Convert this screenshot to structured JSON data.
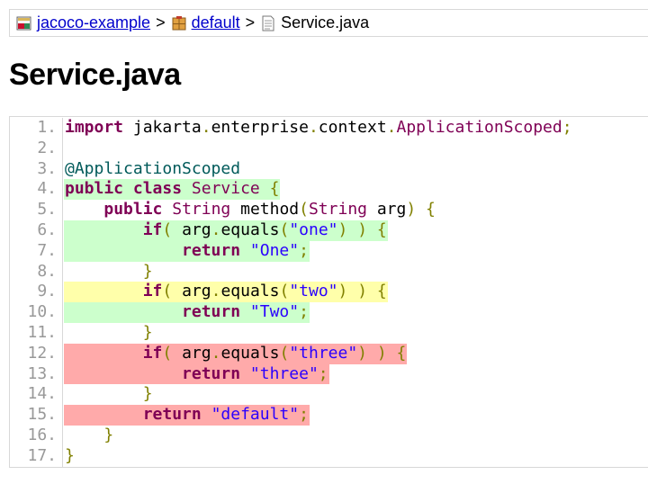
{
  "breadcrumb": {
    "project": "jacoco-example",
    "sep1": ">",
    "package": "default",
    "sep2": ">",
    "file": "Service.java",
    "project_icon": "project-icon",
    "package_icon": "package-icon",
    "file_icon": "java-file-icon"
  },
  "title": "Service.java",
  "colors": {
    "fully_covered": "#ccffcc",
    "partly_covered": "#ffffaa",
    "not_covered": "#ffaaaa",
    "keyword": "#7f0055",
    "string": "#2a00ff",
    "annotation": "#005a5a"
  },
  "lines": [
    {
      "num": "1.",
      "coverage": "none",
      "branch": "none",
      "segs": [
        [
          "kw",
          "import"
        ],
        [
          "",
          ""
        ],
        [
          "pl",
          " jakarta"
        ],
        [
          "pu",
          "."
        ],
        [
          "pl",
          "enterprise"
        ],
        [
          "pu",
          "."
        ],
        [
          "pl",
          "context"
        ],
        [
          "pu",
          "."
        ],
        [
          "ty",
          "ApplicationScoped"
        ],
        [
          "pu",
          ";"
        ]
      ]
    },
    {
      "num": "2.",
      "coverage": "none",
      "branch": "none",
      "segs": []
    },
    {
      "num": "3.",
      "coverage": "none",
      "branch": "none",
      "segs": [
        [
          "an",
          "@ApplicationScoped"
        ]
      ]
    },
    {
      "num": "4.",
      "coverage": "fc",
      "branch": "none",
      "segs": [
        [
          "kw",
          "public"
        ],
        [
          "pl",
          " "
        ],
        [
          "kw",
          "class"
        ],
        [
          "pl",
          " "
        ],
        [
          "ty",
          "Service"
        ],
        [
          "pl",
          " "
        ],
        [
          "pu",
          "{"
        ]
      ]
    },
    {
      "num": "5.",
      "coverage": "none",
      "branch": "none",
      "segs": [
        [
          "pl",
          "    "
        ],
        [
          "kw",
          "public"
        ],
        [
          "pl",
          " "
        ],
        [
          "ty",
          "String"
        ],
        [
          "pl",
          " method"
        ],
        [
          "pu",
          "("
        ],
        [
          "ty",
          "String"
        ],
        [
          "pl",
          " arg"
        ],
        [
          "pu",
          ")"
        ],
        [
          "pl",
          " "
        ],
        [
          "pu",
          "{"
        ]
      ]
    },
    {
      "num": "6.",
      "coverage": "fc",
      "branch": "green",
      "segs": [
        [
          "pl",
          "        "
        ],
        [
          "kw",
          "if"
        ],
        [
          "pu",
          "("
        ],
        [
          "pl",
          " arg"
        ],
        [
          "pu",
          "."
        ],
        [
          "pl",
          "equals"
        ],
        [
          "pu",
          "("
        ],
        [
          "st",
          "\"one\""
        ],
        [
          "pu",
          ")"
        ],
        [
          "pl",
          " "
        ],
        [
          "pu",
          ")"
        ],
        [
          "pl",
          " "
        ],
        [
          "pu",
          "{"
        ]
      ]
    },
    {
      "num": "7.",
      "coverage": "fc",
      "branch": "none",
      "segs": [
        [
          "pl",
          "            "
        ],
        [
          "kw",
          "return"
        ],
        [
          "pl",
          " "
        ],
        [
          "st",
          "\"One\""
        ],
        [
          "pu",
          ";"
        ]
      ]
    },
    {
      "num": "8.",
      "coverage": "none",
      "branch": "none",
      "segs": [
        [
          "pl",
          "        "
        ],
        [
          "pu",
          "}"
        ]
      ]
    },
    {
      "num": "9.",
      "coverage": "pc",
      "branch": "yellow",
      "segs": [
        [
          "pl",
          "        "
        ],
        [
          "kw",
          "if"
        ],
        [
          "pu",
          "("
        ],
        [
          "pl",
          " arg"
        ],
        [
          "pu",
          "."
        ],
        [
          "pl",
          "equals"
        ],
        [
          "pu",
          "("
        ],
        [
          "st",
          "\"two\""
        ],
        [
          "pu",
          ")"
        ],
        [
          "pl",
          " "
        ],
        [
          "pu",
          ")"
        ],
        [
          "pl",
          " "
        ],
        [
          "pu",
          "{"
        ]
      ]
    },
    {
      "num": "10.",
      "coverage": "fc",
      "branch": "none",
      "segs": [
        [
          "pl",
          "            "
        ],
        [
          "kw",
          "return"
        ],
        [
          "pl",
          " "
        ],
        [
          "st",
          "\"Two\""
        ],
        [
          "pu",
          ";"
        ]
      ]
    },
    {
      "num": "11.",
      "coverage": "none",
      "branch": "none",
      "segs": [
        [
          "pl",
          "        "
        ],
        [
          "pu",
          "}"
        ]
      ]
    },
    {
      "num": "12.",
      "coverage": "nc",
      "branch": "red",
      "segs": [
        [
          "pl",
          "        "
        ],
        [
          "kw",
          "if"
        ],
        [
          "pu",
          "("
        ],
        [
          "pl",
          " arg"
        ],
        [
          "pu",
          "."
        ],
        [
          "pl",
          "equals"
        ],
        [
          "pu",
          "("
        ],
        [
          "st",
          "\"three\""
        ],
        [
          "pu",
          ")"
        ],
        [
          "pl",
          " "
        ],
        [
          "pu",
          ")"
        ],
        [
          "pl",
          " "
        ],
        [
          "pu",
          "{"
        ]
      ]
    },
    {
      "num": "13.",
      "coverage": "nc",
      "branch": "none",
      "segs": [
        [
          "pl",
          "            "
        ],
        [
          "kw",
          "return"
        ],
        [
          "pl",
          " "
        ],
        [
          "st",
          "\"three\""
        ],
        [
          "pu",
          ";"
        ]
      ]
    },
    {
      "num": "14.",
      "coverage": "none",
      "branch": "none",
      "segs": [
        [
          "pl",
          "        "
        ],
        [
          "pu",
          "}"
        ]
      ]
    },
    {
      "num": "15.",
      "coverage": "nc",
      "branch": "none",
      "segs": [
        [
          "pl",
          "        "
        ],
        [
          "kw",
          "return"
        ],
        [
          "pl",
          " "
        ],
        [
          "st",
          "\"default\""
        ],
        [
          "pu",
          ";"
        ]
      ]
    },
    {
      "num": "16.",
      "coverage": "none",
      "branch": "none",
      "segs": [
        [
          "pl",
          "    "
        ],
        [
          "pu",
          "}"
        ]
      ]
    },
    {
      "num": "17.",
      "coverage": "none",
      "branch": "none",
      "segs": [
        [
          "pu",
          "}"
        ]
      ]
    }
  ]
}
